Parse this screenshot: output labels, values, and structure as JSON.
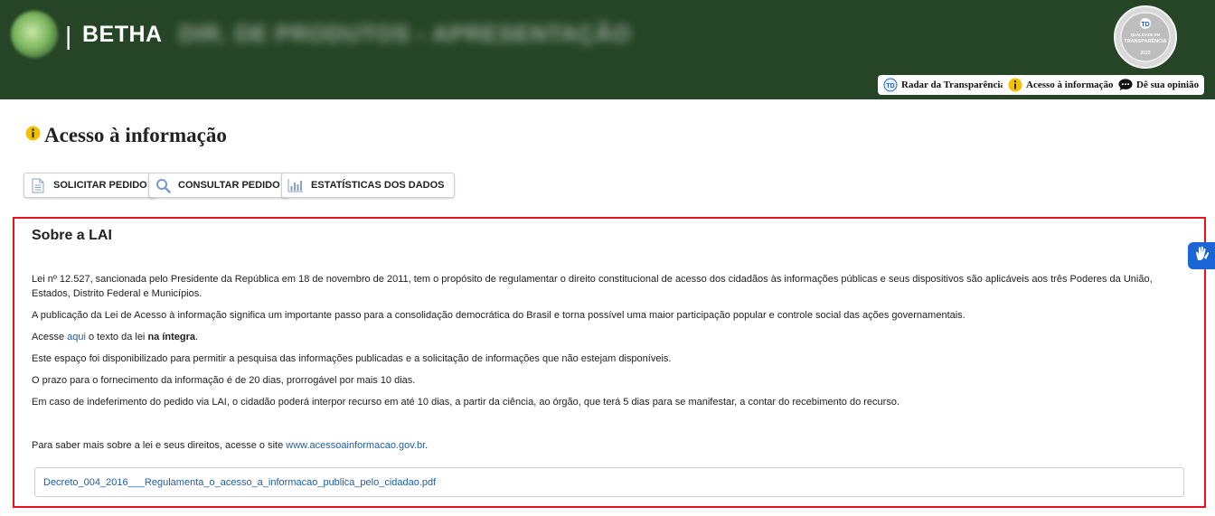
{
  "header": {
    "brand_separator": "|",
    "brand": "BETHA",
    "org_name": "DIR. DE PRODUTOS - APRESENTAÇÃO",
    "seal": {
      "line1": "QUALIDADE EM",
      "line2": "TRANSPARÊNCIA",
      "year": "2022"
    },
    "links": [
      {
        "label": "Radar da Transparência",
        "icon": "radar-icon"
      },
      {
        "label": "Acesso à informação",
        "icon": "info-icon"
      },
      {
        "label": "Dê sua opinião",
        "icon": "chat-bubble-icon"
      }
    ]
  },
  "page": {
    "title": "Acesso à informação",
    "actions": [
      {
        "label": "SOLICITAR PEDIDO",
        "icon": "document-icon"
      },
      {
        "label": "CONSULTAR PEDIDO",
        "icon": "search-icon"
      },
      {
        "label": "ESTATÍSTICAS DOS DADOS",
        "icon": "bar-chart-icon"
      }
    ]
  },
  "lai": {
    "title": "Sobre a LAI",
    "p1": "Lei nº 12.527, sancionada pelo Presidente da República em 18 de novembro de 2011, tem o propósito de regulamentar o direito constitucional de acesso dos cidadãos às informações públicas e seus dispositivos são aplicáveis aos três Poderes da União, Estados, Distrito Federal e Municípios.",
    "p2": "A publicação da Lei de Acesso à informação significa um importante passo para a consolidação democrática do Brasil e torna possível uma maior participação popular e controle social das ações governamentais.",
    "p3_prefix": "Acesse",
    "p3_link": "aqui",
    "p3_middle": "o texto da lei",
    "p3_bold": "na íntegra",
    "p3_suffix": ".",
    "p4": "Este espaço foi disponibilizado para permitir a pesquisa das informações publicadas e a solicitação de informações que não estejam disponíveis.",
    "p5": "O prazo para o fornecimento da informação é de 20 dias, prorrogável por mais 10 dias.",
    "p6": "Em caso de indeferimento do pedido via LAI, o cidadão poderá interpor recurso em até 10 dias, a partir da ciência, ao órgão, que terá 5 dias para se manifestar, a contar do recebimento do recurso.",
    "p7_prefix": "Para saber mais sobre a lei e seus direitos, acesse o site",
    "p7_link": "www.acessoainformacao.gov.br",
    "p7_suffix": ".",
    "file": "Decreto_004_2016___Regulamenta_o_acesso_a_informacao_publica_pelo_cidadao.pdf"
  },
  "colors": {
    "header_bg": "#264527",
    "link": "#1f5fa8",
    "highlight_border": "#e8141a",
    "vlibras": "#1a66d6"
  }
}
